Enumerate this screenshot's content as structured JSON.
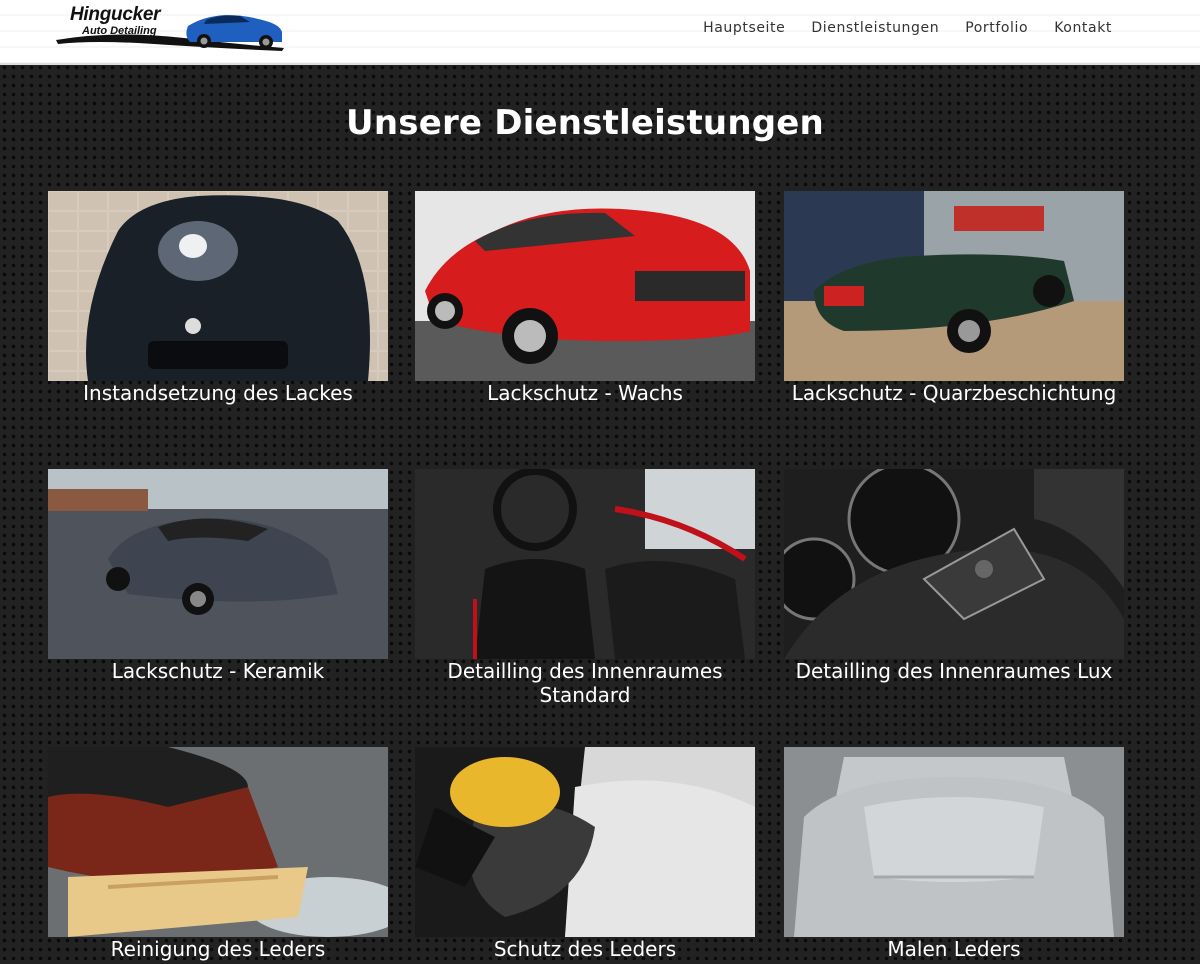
{
  "brand": {
    "name": "Hingucker",
    "tagline": "Auto Detailing"
  },
  "nav": {
    "items": [
      {
        "label": "Hauptseite"
      },
      {
        "label": "Dienstleistungen"
      },
      {
        "label": "Portfolio"
      },
      {
        "label": "Kontakt"
      }
    ]
  },
  "main": {
    "title": "Unsere Dienstleistungen",
    "services": [
      {
        "title": "Instandsetzung des Lackes",
        "image": "black-bmw-hood"
      },
      {
        "title": "Lackschutz - Wachs",
        "image": "red-alfa-romeo"
      },
      {
        "title": "Lackschutz - Quarzbeschichtung",
        "image": "green-triumph-roadster"
      },
      {
        "title": "Lackschutz - Keramik",
        "image": "grey-audi-r8"
      },
      {
        "title": "Detailling des Innenraumes Standard",
        "image": "mini-interior"
      },
      {
        "title": "Detailling des Innenraumes Lux",
        "image": "steering-wheel-dashboard"
      },
      {
        "title": "Reinigung des Leders",
        "image": "leather-brush"
      },
      {
        "title": "Schutz des Leders",
        "image": "leather-applicator"
      },
      {
        "title": "Malen Leders",
        "image": "grey-leather-seat"
      }
    ]
  }
}
